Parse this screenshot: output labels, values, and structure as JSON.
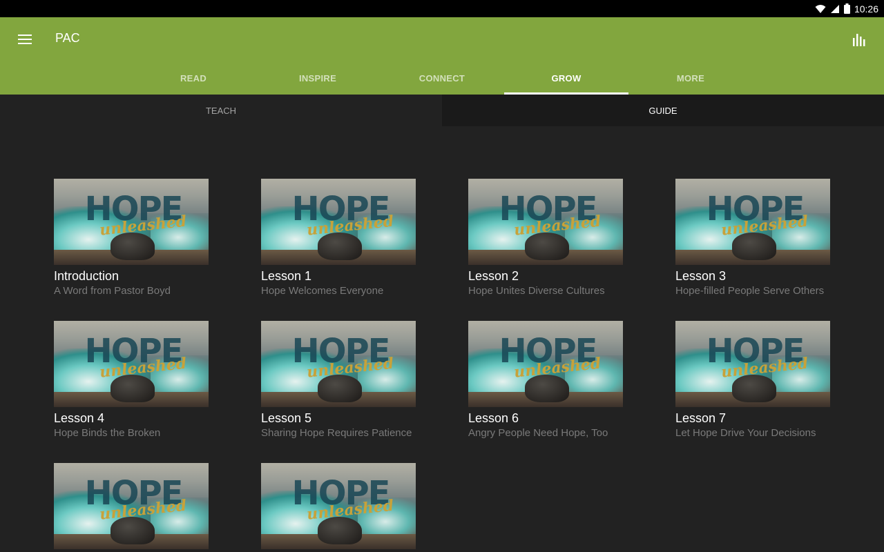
{
  "status_bar": {
    "time": "10:26",
    "icons": [
      "wifi-icon",
      "cell-signal-icon",
      "battery-icon"
    ]
  },
  "app_bar": {
    "title": "PAC",
    "menu_icon": "menu-icon",
    "stats_icon": "bar-chart-icon",
    "color": "#82a63e"
  },
  "main_tabs": [
    {
      "label": "READ"
    },
    {
      "label": "INSPIRE"
    },
    {
      "label": "CONNECT"
    },
    {
      "label": "GROW"
    },
    {
      "label": "MORE"
    }
  ],
  "active_main_tab": "GROW",
  "sub_tabs": [
    {
      "label": "TEACH"
    },
    {
      "label": "GUIDE"
    }
  ],
  "active_sub_tab": "GUIDE",
  "thumbnail": {
    "title_word": "HOPE",
    "script_word": "unleashed"
  },
  "lessons": [
    {
      "title": "Introduction",
      "subtitle": "A Word from Pastor Boyd"
    },
    {
      "title": "Lesson 1",
      "subtitle": "Hope Welcomes Everyone"
    },
    {
      "title": "Lesson 2",
      "subtitle": "Hope Unites Diverse Cultures"
    },
    {
      "title": "Lesson 3",
      "subtitle": "Hope-filled People Serve Others"
    },
    {
      "title": "Lesson 4",
      "subtitle": "Hope Binds the Broken"
    },
    {
      "title": "Lesson 5",
      "subtitle": "Sharing Hope Requires Patience"
    },
    {
      "title": "Lesson 6",
      "subtitle": "Angry People Need Hope, Too"
    },
    {
      "title": "Lesson 7",
      "subtitle": "Let Hope Drive Your Decisions"
    },
    {
      "title": "",
      "subtitle": ""
    },
    {
      "title": "",
      "subtitle": ""
    }
  ]
}
